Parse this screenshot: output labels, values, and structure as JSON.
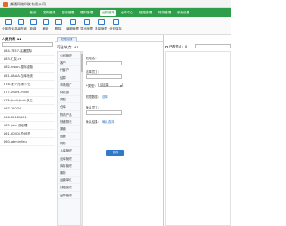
{
  "app": {
    "title": "美通网络科技有限公司"
  },
  "nav": {
    "tabs": [
      "首页",
      "发货管理",
      "签收管理",
      "理财管理",
      "运费管理",
      "仓库中心",
      "链路管理",
      "财务管理",
      "系统设置"
    ],
    "active_index": 4
  },
  "toolbar": {
    "items": [
      "全部查询",
      "高级查询",
      "新增",
      "刷新",
      "删除",
      "编辑管理",
      "导出管理",
      "批量管理",
      "全部保存"
    ]
  },
  "left": {
    "header": "人员列表-11",
    "items": [
      "184-7857-高通国际",
      "183-仁友-ra",
      "182-roson-国际金融",
      "181-AAAA-仓库系统",
      "178-宋少元-宋少元",
      "177-zhuhi-zhuhi",
      "172-Jindi-Jindi-美工",
      "167-12034",
      "166-20181101",
      "165-jzkz-总经理",
      "161-XD(D)-总经理",
      "160-admin-feu"
    ]
  },
  "middle": {
    "tab_label": "权限设置",
    "header": "可选节点：41",
    "props": [
      "公司管理",
      "客户",
      "代客户",
      "结算",
      "市场推广",
      "财务部",
      "类型",
      "仓库",
      "物流产品",
      "快递物流",
      "渠道",
      "运营",
      "财务",
      "入库管理",
      "出库管理",
      "库存管理",
      "服务",
      "运输单位",
      "线路管理",
      "运单管理"
    ],
    "form": {
      "name_label": "权限名：",
      "name_value": "",
      "employee_label": "选择员工：",
      "employee_value": "",
      "type_label": "* 类型：",
      "type_select": "请选择",
      "perm_label": "权限数据：",
      "perm_link": "选择",
      "confirm_label": "确认员工：",
      "confirm_value": "",
      "note_label": "确认结果：",
      "note_link": "确认选择",
      "save_label": "保存"
    }
  },
  "right": {
    "header": "已选节点：0",
    "search_placeholder": ""
  }
}
